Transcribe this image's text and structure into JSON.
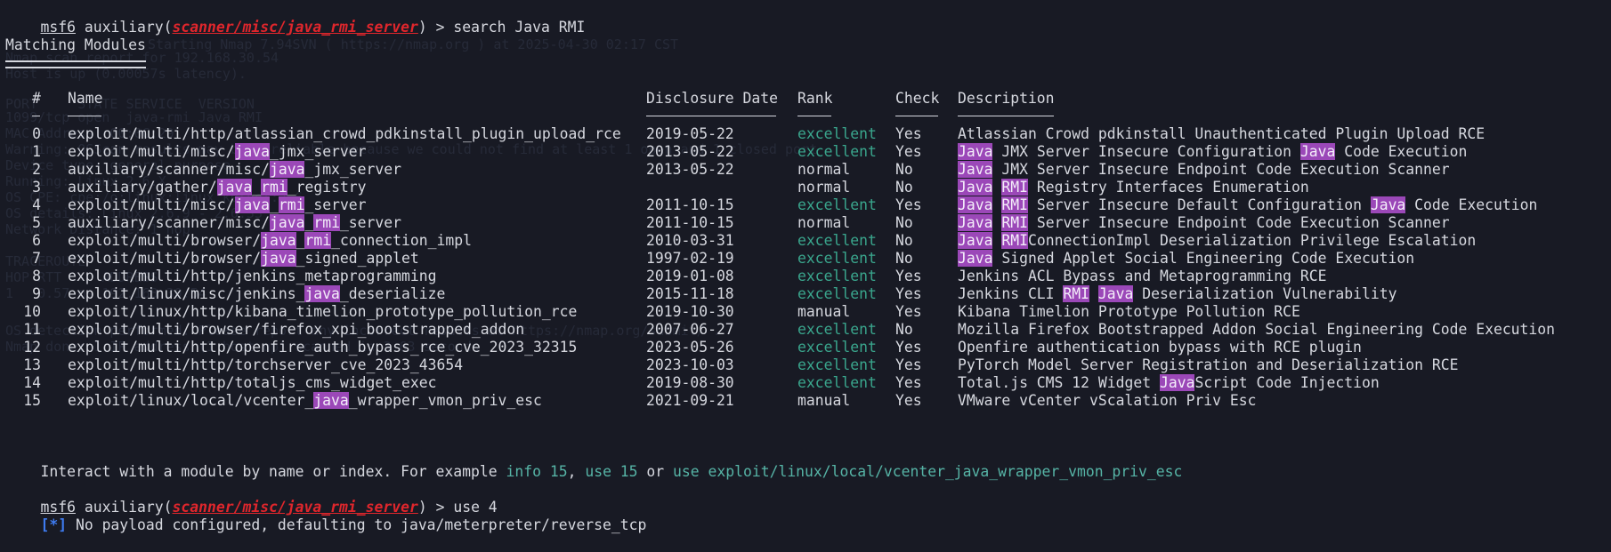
{
  "prompt1": {
    "user": "msf6",
    "module_type": "auxiliary",
    "module_path": "scanner/misc/java_rmi_server",
    "command": "search Java RMI"
  },
  "heading": "Matching Modules",
  "table": {
    "headers": {
      "num": "#",
      "name": "Name",
      "date": "Disclosure Date",
      "rank": "Rank",
      "check": "Check",
      "desc": "Description"
    },
    "rows": [
      {
        "num": "0",
        "name": "exploit/multi/http/atlassian_crowd_pdkinstall_plugin_upload_rce",
        "date": "2019-05-22",
        "rank": "excellent",
        "check": "Yes",
        "desc": "Atlassian Crowd pdkinstall Unauthenticated Plugin Upload RCE"
      },
      {
        "num": "1",
        "name": "exploit/multi/misc/java_jmx_server",
        "date": "2013-05-22",
        "rank": "excellent",
        "check": "Yes",
        "desc": "Java JMX Server Insecure Configuration Java Code Execution"
      },
      {
        "num": "2",
        "name": "auxiliary/scanner/misc/java_jmx_server",
        "date": "2013-05-22",
        "rank": "normal",
        "check": "No",
        "desc": "Java JMX Server Insecure Endpoint Code Execution Scanner"
      },
      {
        "num": "3",
        "name": "auxiliary/gather/java_rmi_registry",
        "date": "",
        "rank": "normal",
        "check": "No",
        "desc": "Java RMI Registry Interfaces Enumeration"
      },
      {
        "num": "4",
        "name": "exploit/multi/misc/java_rmi_server",
        "date": "2011-10-15",
        "rank": "excellent",
        "check": "Yes",
        "desc": "Java RMI Server Insecure Default Configuration Java Code Execution"
      },
      {
        "num": "5",
        "name": "auxiliary/scanner/misc/java_rmi_server",
        "date": "2011-10-15",
        "rank": "normal",
        "check": "No",
        "desc": "Java RMI Server Insecure Endpoint Code Execution Scanner"
      },
      {
        "num": "6",
        "name": "exploit/multi/browser/java_rmi_connection_impl",
        "date": "2010-03-31",
        "rank": "excellent",
        "check": "No",
        "desc": "Java RMIConnectionImpl Deserialization Privilege Escalation"
      },
      {
        "num": "7",
        "name": "exploit/multi/browser/java_signed_applet",
        "date": "1997-02-19",
        "rank": "excellent",
        "check": "No",
        "desc": "Java Signed Applet Social Engineering Code Execution"
      },
      {
        "num": "8",
        "name": "exploit/multi/http/jenkins_metaprogramming",
        "date": "2019-01-08",
        "rank": "excellent",
        "check": "Yes",
        "desc": "Jenkins ACL Bypass and Metaprogramming RCE"
      },
      {
        "num": "9",
        "name": "exploit/linux/misc/jenkins_java_deserialize",
        "date": "2015-11-18",
        "rank": "excellent",
        "check": "Yes",
        "desc": "Jenkins CLI RMI Java Deserialization Vulnerability"
      },
      {
        "num": "10",
        "name": "exploit/linux/http/kibana_timelion_prototype_pollution_rce",
        "date": "2019-10-30",
        "rank": "manual",
        "check": "Yes",
        "desc": "Kibana Timelion Prototype Pollution RCE"
      },
      {
        "num": "11",
        "name": "exploit/multi/browser/firefox_xpi_bootstrapped_addon",
        "date": "2007-06-27",
        "rank": "excellent",
        "check": "No",
        "desc": "Mozilla Firefox Bootstrapped Addon Social Engineering Code Execution"
      },
      {
        "num": "12",
        "name": "exploit/multi/http/openfire_auth_bypass_rce_cve_2023_32315",
        "date": "2023-05-26",
        "rank": "excellent",
        "check": "Yes",
        "desc": "Openfire authentication bypass with RCE plugin"
      },
      {
        "num": "13",
        "name": "exploit/multi/http/torchserver_cve_2023_43654",
        "date": "2023-10-03",
        "rank": "excellent",
        "check": "Yes",
        "desc": "PyTorch Model Server Registration and Deserialization RCE"
      },
      {
        "num": "14",
        "name": "exploit/multi/http/totaljs_cms_widget_exec",
        "date": "2019-08-30",
        "rank": "excellent",
        "check": "Yes",
        "desc": "Total.js CMS 12 Widget JavaScript Code Injection"
      },
      {
        "num": "15",
        "name": "exploit/linux/local/vcenter_java_wrapper_vmon_priv_esc",
        "date": "2021-09-21",
        "rank": "manual",
        "check": "Yes",
        "desc": "VMware vCenter vScalation Priv Esc"
      }
    ]
  },
  "interact": {
    "prefix": "Interact with a module by name or index. For example ",
    "info": "info 15",
    "comma": ", ",
    "use_idx": "use 15",
    "or": " or ",
    "use_name": "use exploit/linux/local/vcenter_java_wrapper_vmon_priv_esc"
  },
  "prompt2": {
    "user": "msf6",
    "module_type": "auxiliary",
    "module_path": "scanner/misc/java_rmi_server",
    "command": "use 4"
  },
  "status": {
    "marker": "[*]",
    "text": " No payload configured, defaulting to java/meterpreter/reverse_tcp"
  },
  "background_text": [
    "Starting Nmap 7.94SVN ( https://nmap.org ) at 2025-04-30 02:17 CST",
    "Nmap scan report for 192.168.30.54",
    "Host is up (0.00057s latency).",
    "PORT     STATE SERVICE  VERSION",
    "1099/tcp open  java-rmi Java RMI",
    "MAC Address: 00:0C:29",
    "Warning: OSScan results may be unreliable because we could not find at least 1 open and 1 closed port",
    "Device type: general purpose",
    "Running: Linux 2.6.X",
    "OS CPE: cpe:/o:linux:linux_kernel:2.6",
    "OS details: Linux 2.6.9 - 2.6.33",
    "Network Distance: 1 hop",
    "TRACEROUTE",
    "HOP RTT     ADDRESS",
    "1   0.57 ms 192.168.30.54",
    "OS detection performed. Please report any incorrect results at https://nmap.org/submit/ .",
    "Nmap done: 1 IP address (1 host up) scanned in 3.63 seconds"
  ],
  "colors": {
    "background": "#181a24",
    "text": "#d6d8df",
    "prompt_module": "#e0262c",
    "rank_excellent": "#3aa68d",
    "highlight_bg": "#9b48b8",
    "status_marker": "#3e7bf0",
    "hint": "#56b4a6"
  }
}
